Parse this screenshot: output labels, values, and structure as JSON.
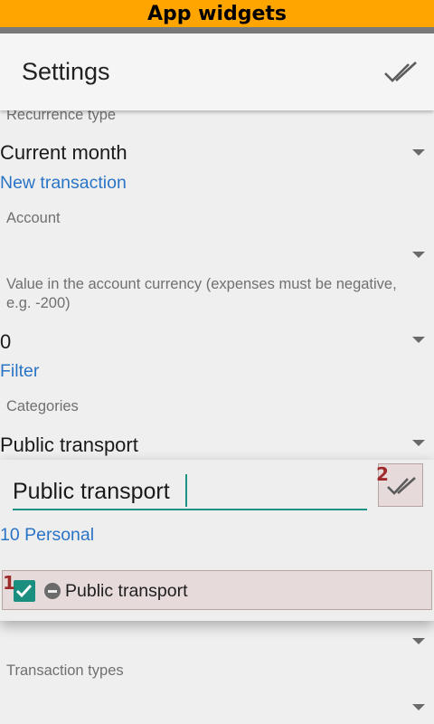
{
  "banner": {
    "title": "App widgets"
  },
  "appbar": {
    "title": "Settings",
    "confirm_icon": "double-check-icon"
  },
  "recurrence": {
    "label": "Recurrence type",
    "value": "Current month"
  },
  "sections": {
    "new_transaction": "New transaction",
    "filter": "Filter"
  },
  "account": {
    "label": "Account",
    "value": ""
  },
  "amount": {
    "label_line1": "Value in the account currency (expenses must be negative,",
    "label_line2": "e.g. -200)",
    "value": "0"
  },
  "categories": {
    "label": "Categories",
    "value": "Public transport"
  },
  "category_picker": {
    "search_value": "Public transport",
    "group_label": "10 Personal",
    "confirm_icon": "double-check-icon",
    "annotations": {
      "confirm": "2",
      "result": "1"
    },
    "result": {
      "label": "Public transport",
      "checked": true,
      "icon": "minus-circle-icon"
    }
  },
  "transaction_types": {
    "label": "Transaction types",
    "value": ""
  },
  "colors": {
    "banner": "#ffa500",
    "accent": "#1a9384",
    "link": "#2a74c6",
    "annotation": "#9e2a2a"
  }
}
